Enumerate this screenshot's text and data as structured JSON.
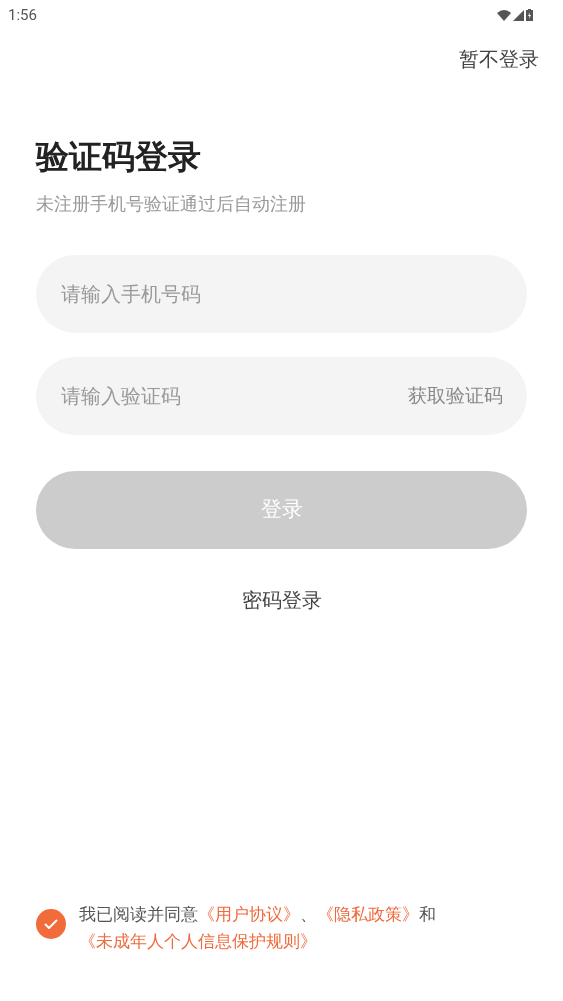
{
  "status_bar": {
    "time": "1:56"
  },
  "skip": "暂不登录",
  "title": "验证码登录",
  "subtitle": "未注册手机号验证通过后自动注册",
  "phone_field": {
    "placeholder": "请输入手机号码"
  },
  "code_field": {
    "placeholder": "请输入验证码",
    "action": "获取验证码"
  },
  "login_button": {
    "label": "登录",
    "disabled": true
  },
  "password_login": "密码登录",
  "agreement": {
    "checked": true,
    "parts": [
      {
        "kind": "text",
        "text": "我已阅读并同意"
      },
      {
        "kind": "link",
        "text": "《用户协议》"
      },
      {
        "kind": "text",
        "text": "、"
      },
      {
        "kind": "link",
        "text": "《隐私政策》"
      },
      {
        "kind": "text",
        "text": "和"
      },
      {
        "kind": "link",
        "text": "《未成年人个人信息保护规则》"
      }
    ]
  }
}
